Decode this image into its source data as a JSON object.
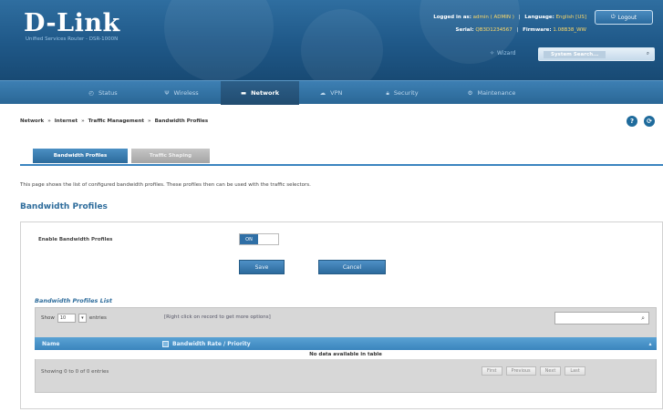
{
  "header": {
    "logo": "D-Link",
    "subtitle": "Unified Services Router - DSR-1000N",
    "logged_in_label": "Logged in as:",
    "logged_in_value": "admin ( ADMIN )",
    "language_label": "Language:",
    "language_value": "English [US]",
    "serial_label": "Serial:",
    "serial_value": "QB3D1234567",
    "firmware_label": "Firmware:",
    "firmware_value": "1.08B38_WW",
    "logout": "Logout",
    "wizard": "Wizard",
    "system_search": "System Search..."
  },
  "nav": {
    "items": [
      {
        "label": "Status"
      },
      {
        "label": "Wireless"
      },
      {
        "label": "Network"
      },
      {
        "label": "VPN"
      },
      {
        "label": "Security"
      },
      {
        "label": "Maintenance"
      }
    ],
    "active": "Network"
  },
  "breadcrumb": [
    "Network",
    "Internet",
    "Traffic Management",
    "Bandwidth Profiles"
  ],
  "tabs": [
    {
      "label": "Bandwidth Profiles",
      "active": true
    },
    {
      "label": "Traffic Shaping",
      "active": false
    }
  ],
  "description": "This page shows the list of configured bandwidth profiles. These profiles then can be used with the traffic selectors.",
  "section_title": "Bandwidth Profiles",
  "form": {
    "enable_label": "Enable Bandwidth Profiles",
    "toggle_state": "ON",
    "save": "Save",
    "cancel": "Cancel"
  },
  "list": {
    "title": "Bandwidth Profiles List",
    "show_label": "Show",
    "show_value": "10",
    "entries_label": "entries",
    "right_click_hint": "[Right click on record to get more options]",
    "columns": [
      "Name",
      "Bandwidth Rate / Priority"
    ],
    "empty_message": "No data available in table",
    "showing": "Showing 0 to 0 of 0 entries",
    "pager": [
      "First",
      "Previous",
      "Next",
      "Last"
    ]
  },
  "colors": {
    "header_blue": "#1f5888",
    "accent": "#3a84c0",
    "button": "#2c6a9c"
  }
}
